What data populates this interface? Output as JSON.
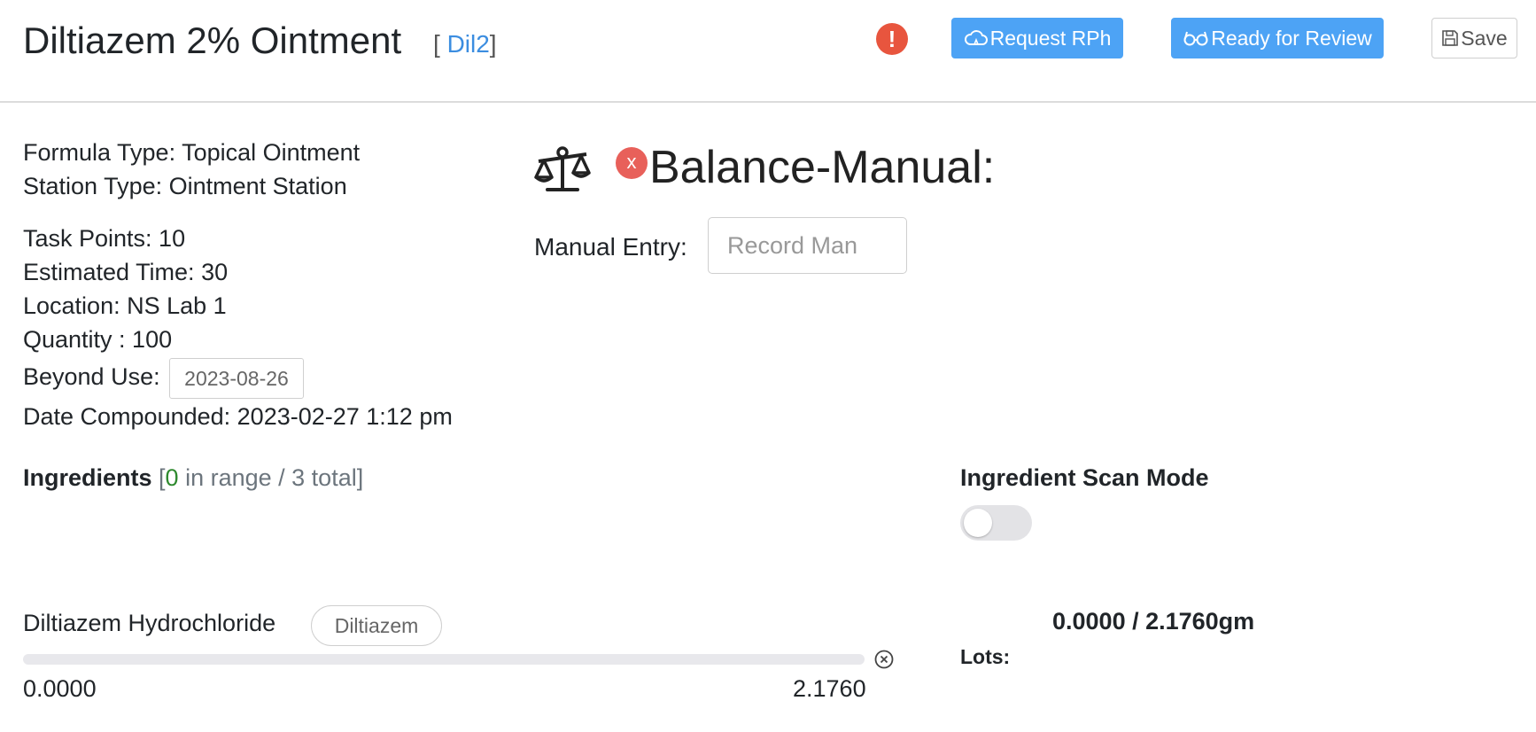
{
  "header": {
    "title": "Diltiazem 2% Ointment",
    "code_open": "[ ",
    "code": "Dil2",
    "code_close": "]",
    "alert_icon": "exclamation-icon",
    "request_rph_label": "Request RPh",
    "ready_for_review_label": "Ready for Review",
    "save_label": "Save"
  },
  "info": {
    "formula_type": "Formula Type: Topical Ointment",
    "station_type": "Station Type: Ointment Station",
    "task_points": "Task Points: 10",
    "estimated_time": "Estimated Time: 30",
    "location": "Location: NS Lab 1",
    "quantity": "Quantity : 100",
    "beyond_use_label": "Beyond Use:",
    "beyond_use_value": "2023-08-26",
    "date_compounded": "Date Compounded: 2023-02-27 1:12 pm"
  },
  "balance": {
    "icon": "balance-scale-icon",
    "status_badge": "x",
    "title": "Balance-Manual:",
    "manual_entry_label": "Manual Entry:",
    "manual_entry_placeholder": "Record Man"
  },
  "ingredients": {
    "heading": "Ingredients",
    "bracket_open": " [",
    "in_range_count": "0",
    "summary_rest": " in range / 3 total",
    "bracket_close": "]",
    "scan_mode_label": "Ingredient Scan Mode",
    "scan_mode_on": false,
    "items": [
      {
        "name": "Diltiazem Hydrochloride",
        "tag": "Diltiazem",
        "min": "0.0000",
        "max": "2.1760",
        "progress": 0,
        "amount": "0.0000 /  2.1760gm",
        "lots_label": "Lots:"
      }
    ]
  },
  "colors": {
    "primary": "#4da3f5",
    "danger": "#e8553e",
    "success": "#2f8a2f",
    "link": "#3b8de0"
  }
}
